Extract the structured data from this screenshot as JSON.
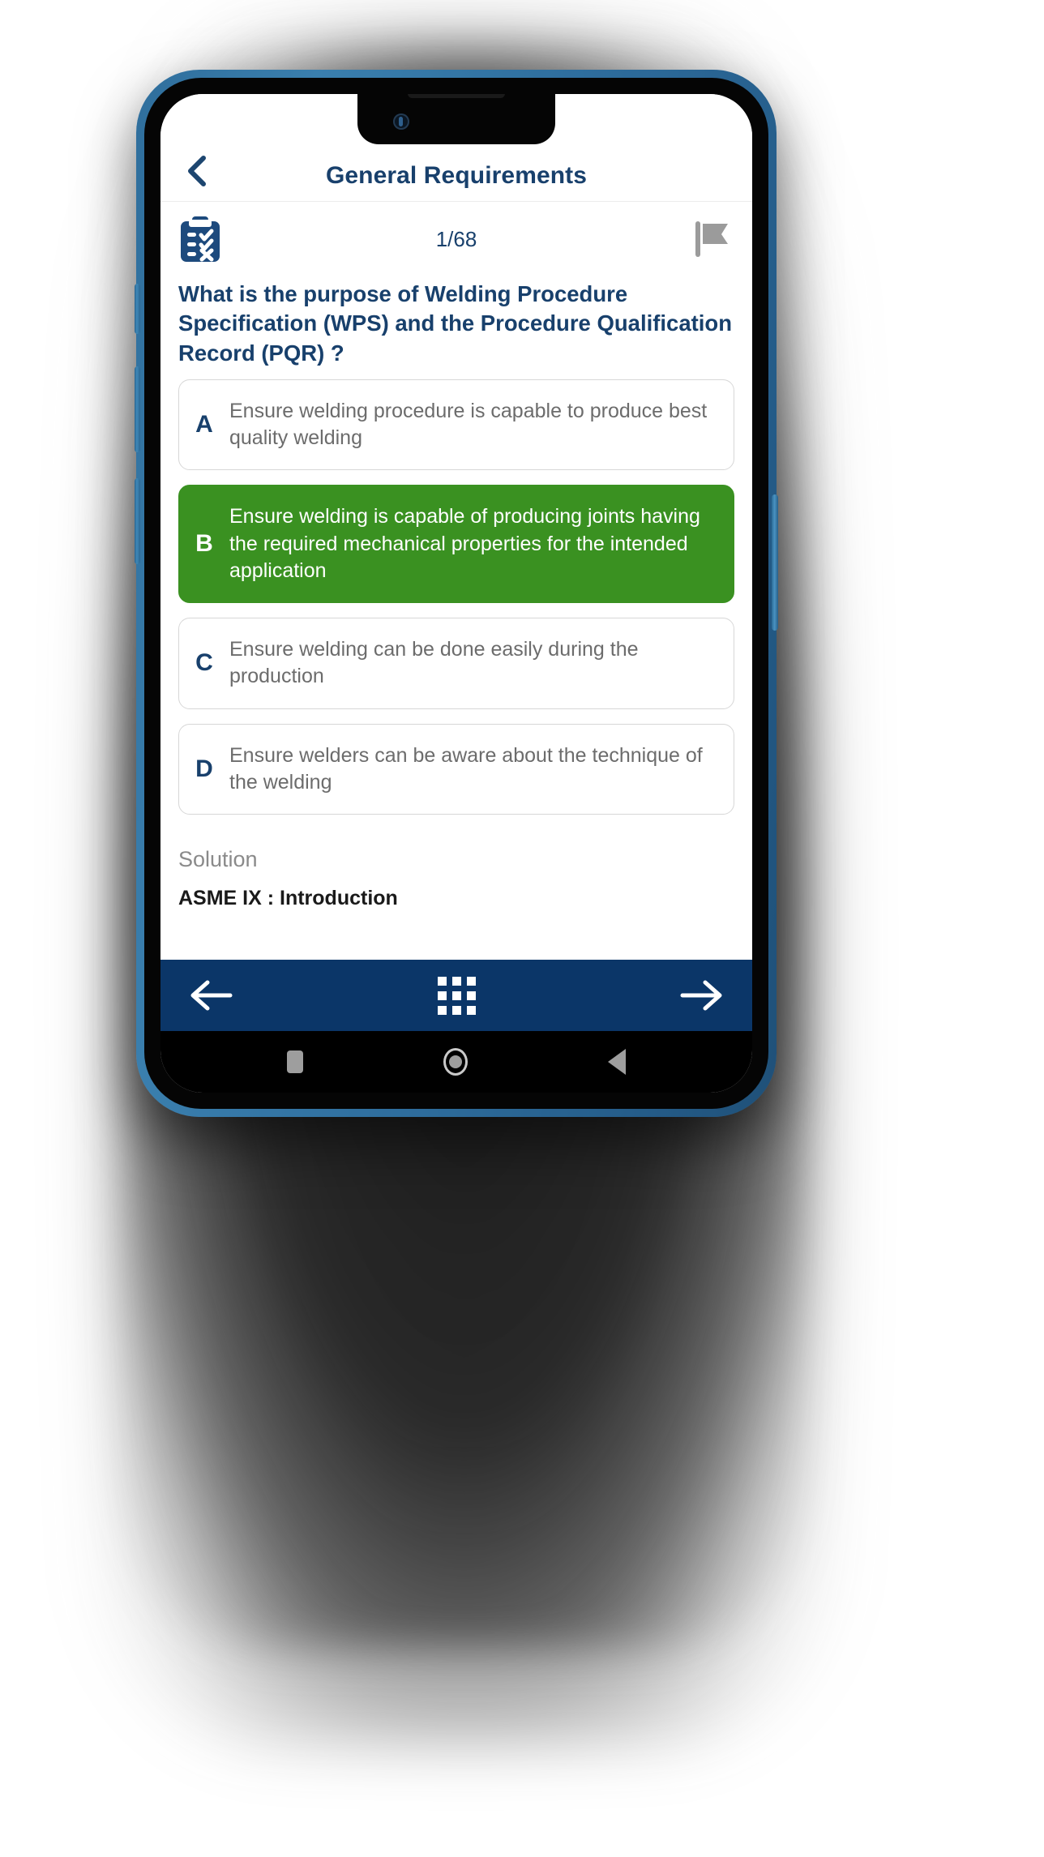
{
  "header": {
    "title": "General Requirements",
    "back_icon": "chevron-left-icon"
  },
  "meta": {
    "quiz_icon": "clipboard-checklist-icon",
    "counter": "1/68",
    "flag_icon": "flag-icon"
  },
  "question": {
    "text": "What is the purpose of Welding Procedure Specification (WPS) and the Procedure Qualification Record (PQR) ?"
  },
  "options": [
    {
      "letter": "A",
      "text": "Ensure welding procedure is capable to produce best quality welding",
      "selected": false
    },
    {
      "letter": "B",
      "text": "Ensure welding is capable of producing joints having the required mechanical properties for the intended application",
      "selected": true
    },
    {
      "letter": "C",
      "text": "Ensure welding can be done easily during the production",
      "selected": false
    },
    {
      "letter": "D",
      "text": "Ensure welders can be aware about the technique of the welding",
      "selected": false
    }
  ],
  "solution": {
    "label": "Solution",
    "text": "ASME IX : Introduction"
  },
  "bottom_nav": {
    "prev_icon": "arrow-left-icon",
    "grid_icon": "grid-menu-icon",
    "next_icon": "arrow-right-icon"
  },
  "android_nav": {
    "recents_icon": "square-recents-icon",
    "home_icon": "circle-home-icon",
    "back_icon": "triangle-back-icon"
  },
  "colors": {
    "navy": "#0b3668",
    "header_navy": "#18406c",
    "correct_green": "#3a9121",
    "option_text_gray": "#6c6c6c",
    "flag_gray": "#9b9b9b",
    "phone_frame_blue": "#2e6d9d"
  }
}
